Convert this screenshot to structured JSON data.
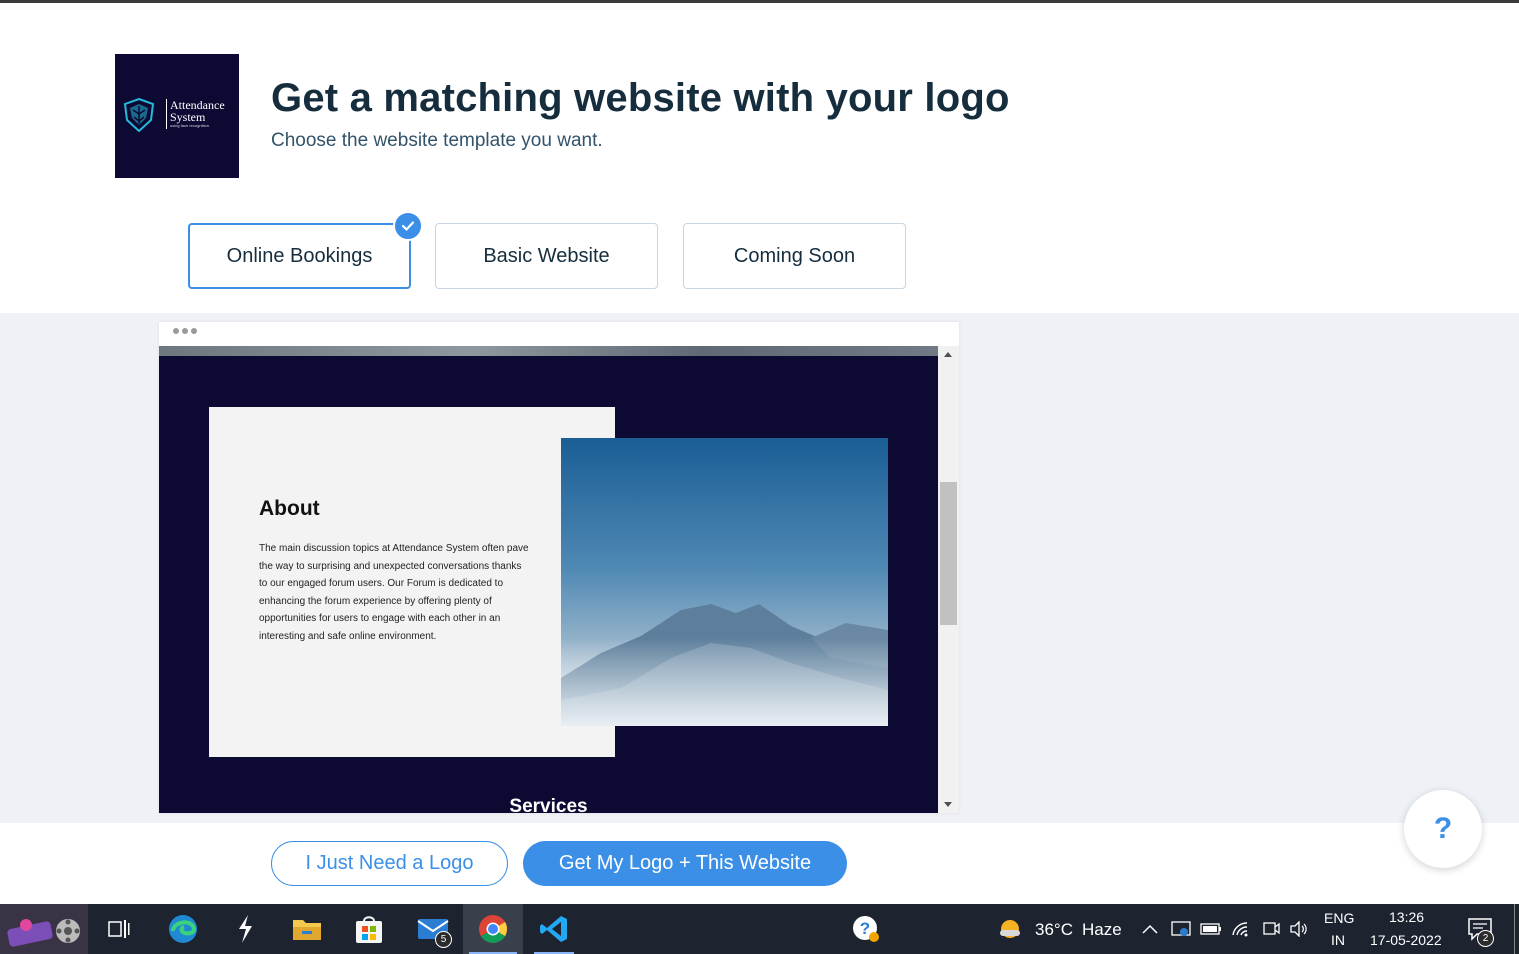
{
  "header": {
    "logo": {
      "name_line1": "Attendance",
      "name_line2": "System",
      "tagline": "using face recognition",
      "background_color": "#0c0a33"
    },
    "title": "Get a matching website with your logo",
    "subtitle": "Choose the website template you want."
  },
  "template_tabs": [
    {
      "label": "Online Bookings",
      "selected": true
    },
    {
      "label": "Basic Website",
      "selected": false
    },
    {
      "label": "Coming Soon",
      "selected": false
    }
  ],
  "preview": {
    "about_title": "About",
    "about_text": "The main discussion topics at Attendance System often pave the way to surprising and unexpected conversations thanks to our engaged forum users. Our Forum is dedicated to enhancing the forum experience by offering plenty of opportunities for users to engage with each other in an interesting and safe online environment.",
    "next_section_label": "Services",
    "site_background_color": "#0c0a33"
  },
  "actions": {
    "logo_only_label": "I Just Need a Logo",
    "logo_and_website_label": "Get My Logo + This Website",
    "help_label": "?"
  },
  "colors": {
    "accent": "#3b8fe6",
    "heading": "#162d3d",
    "preview_bg": "#eef1f5"
  },
  "taskbar": {
    "apps": [
      "game-launcher-icon",
      "task-view-icon",
      "edge-icon",
      "app-icon",
      "file-explorer-icon",
      "store-icon",
      "mail-icon",
      "chrome-icon",
      "vscode-icon"
    ],
    "mail_badge": "5",
    "weather": {
      "temperature": "36°C",
      "condition": "Haze"
    },
    "language_line1": "ENG",
    "language_line2": "IN",
    "time": "13:26",
    "date": "17-05-2022",
    "notification_count": "2"
  }
}
